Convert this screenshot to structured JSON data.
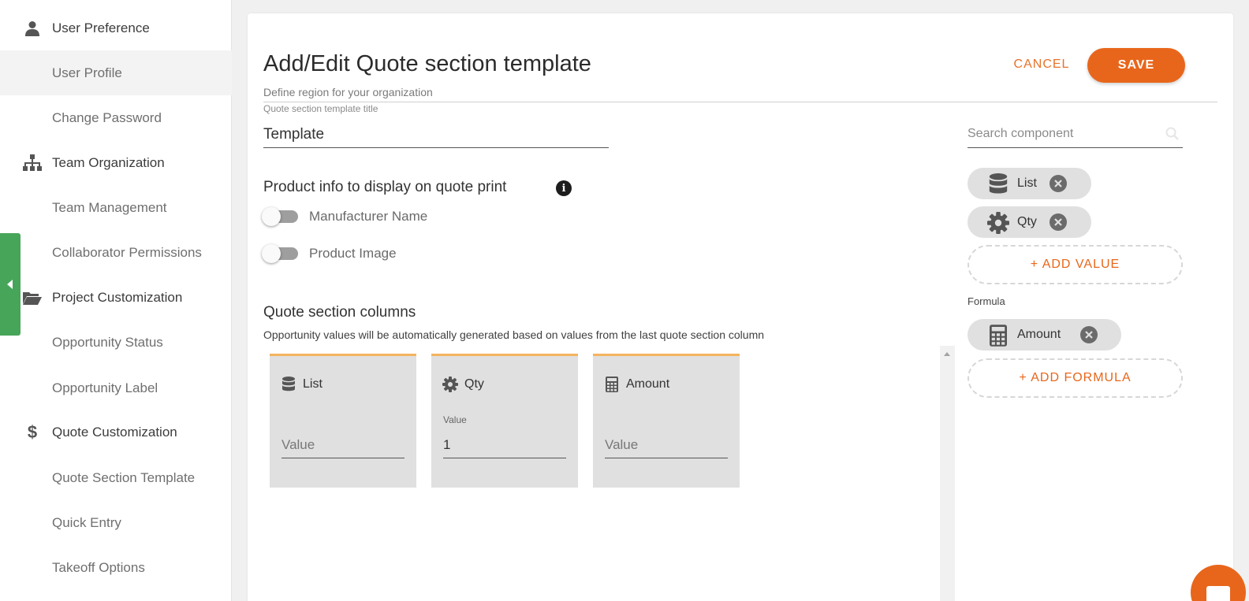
{
  "sidebar": {
    "user_preference": "User Preference",
    "user_profile": "User Profile",
    "change_password": "Change Password",
    "team_organization": "Team Organization",
    "team_management": "Team Management",
    "collaborator_permissions": "Collaborator Permissions",
    "project_customization": "Project Customization",
    "opportunity_status": "Opportunity Status",
    "opportunity_label": "Opportunity Label",
    "quote_customization": "Quote Customization",
    "quote_section_template": "Quote Section Template",
    "quick_entry": "Quick Entry",
    "takeoff_options": "Takeoff Options"
  },
  "header": {
    "title": "Add/Edit Quote section template",
    "subtitle": "Define region for your organization",
    "cancel_label": "CANCEL",
    "save_label": "SAVE"
  },
  "form": {
    "title_label": "Quote section template title",
    "title_value": "Template",
    "product_info_heading": "Product info to display on quote print",
    "toggles": [
      {
        "label": "Manufacturer Name",
        "on": false
      },
      {
        "label": "Product Image",
        "on": false
      }
    ],
    "columns_heading": "Quote section columns",
    "columns_description": "Opportunity values will be automatically generated based on values from the last quote section column",
    "columns": [
      {
        "name": "List",
        "icon": "database-icon",
        "value_label": "",
        "value": "",
        "placeholder": "Value"
      },
      {
        "name": "Qty",
        "icon": "gear-icon",
        "value_label": "Value",
        "value": "1",
        "placeholder": "Value"
      },
      {
        "name": "Amount",
        "icon": "calculator-icon",
        "value_label": "",
        "value": "",
        "placeholder": "Value"
      }
    ]
  },
  "components": {
    "search_placeholder": "Search component",
    "values": [
      {
        "label": "List",
        "icon": "database-icon"
      },
      {
        "label": "Qty",
        "icon": "gear-icon"
      }
    ],
    "add_value_label": "+ ADD VALUE",
    "formula_label": "Formula",
    "formulas": [
      {
        "label": "Amount",
        "icon": "calculator-icon"
      }
    ],
    "add_formula_label": "+ ADD FORMULA"
  },
  "colors": {
    "accent": "#e8661b",
    "sidebar_tab": "#47a55a",
    "column_top_border": "#f4b35e"
  }
}
